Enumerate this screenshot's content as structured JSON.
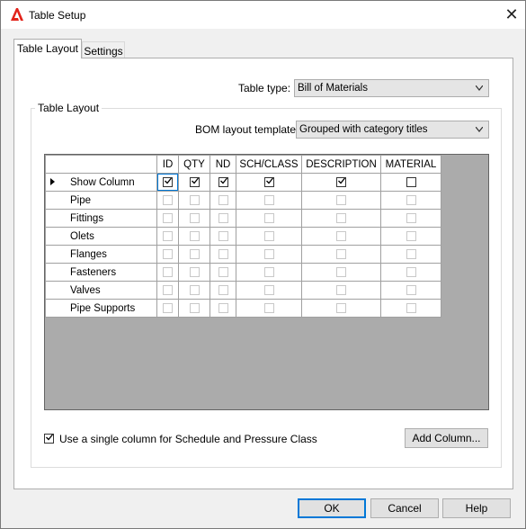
{
  "window": {
    "title": "Table Setup",
    "close_glyph": "✕"
  },
  "tabs": [
    {
      "label": "Table Layout"
    },
    {
      "label": "Settings"
    }
  ],
  "table_type": {
    "label": "Table type:",
    "value": "Bill of Materials"
  },
  "group": {
    "title": "Table Layout"
  },
  "bom_template": {
    "label": "BOM layout template:",
    "value": "Grouped with category titles"
  },
  "grid": {
    "columns": [
      "ID",
      "QTY",
      "ND",
      "SCH/CLASS",
      "DESCRIPTION",
      "MATERIAL"
    ],
    "rows": [
      {
        "name": "Show Column",
        "checks": [
          true,
          true,
          true,
          true,
          true,
          false
        ],
        "enabled": true
      },
      {
        "name": "Pipe",
        "checks": [
          false,
          false,
          false,
          false,
          false,
          false
        ],
        "enabled": false
      },
      {
        "name": "Fittings",
        "checks": [
          false,
          false,
          false,
          false,
          false,
          false
        ],
        "enabled": false
      },
      {
        "name": "Olets",
        "checks": [
          false,
          false,
          false,
          false,
          false,
          false
        ],
        "enabled": false
      },
      {
        "name": "Flanges",
        "checks": [
          false,
          false,
          false,
          false,
          false,
          false
        ],
        "enabled": false
      },
      {
        "name": "Fasteners",
        "checks": [
          false,
          false,
          false,
          false,
          false,
          false
        ],
        "enabled": false
      },
      {
        "name": "Valves",
        "checks": [
          false,
          false,
          false,
          false,
          false,
          false
        ],
        "enabled": false
      },
      {
        "name": "Pipe Supports",
        "checks": [
          false,
          false,
          false,
          false,
          false,
          false
        ],
        "enabled": false
      }
    ]
  },
  "single_column": {
    "label": "Use a single column for Schedule and Pressure Class",
    "checked": true
  },
  "buttons": {
    "add_column": "Add Column...",
    "ok": "OK",
    "cancel": "Cancel",
    "help": "Help"
  },
  "colors": {
    "accent": "#0078d7",
    "grid_bg": "#ababab",
    "logo_red": "#e2231a"
  }
}
